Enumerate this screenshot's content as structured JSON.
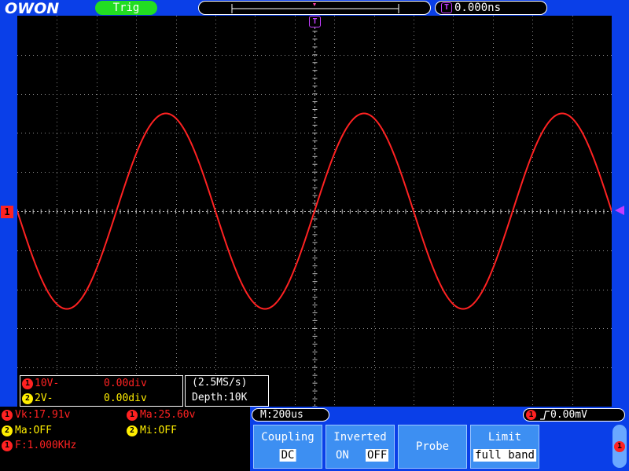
{
  "brand": {
    "logo": "OWON"
  },
  "header": {
    "trig_status": "Trig",
    "trig_time": "0.000ns",
    "trig_icon": "T"
  },
  "channels": {
    "ch1": {
      "num": "1",
      "vdiv": "10V-",
      "pos": "0.00div",
      "color": "#ff2222"
    },
    "ch2": {
      "num": "2",
      "vdiv": "2V-",
      "pos": "0.00div",
      "color": "#ffee00"
    }
  },
  "acquisition": {
    "sample_rate": "(2.5MS/s)",
    "depth": "Depth:10K"
  },
  "measurements": [
    {
      "ch": "1",
      "text": "Vk:17.91v",
      "color": "#ff2222"
    },
    {
      "ch": "1",
      "text": "Ma:25.60v",
      "color": "#ff2222"
    },
    {
      "ch": "2",
      "text": "Ma:OFF",
      "color": "#ffee00"
    },
    {
      "ch": "2",
      "text": "Mi:OFF",
      "color": "#ffee00"
    },
    {
      "ch": "1",
      "text": "F:1.000KHz",
      "color": "#ff2222"
    }
  ],
  "timebase": {
    "label": "M:200us"
  },
  "trigger": {
    "ch": "1",
    "edge_icon": "rising-edge",
    "edge_glyph": "∿",
    "level": "0.00mV"
  },
  "softkeys": {
    "coupling": {
      "label": "Coupling",
      "value": "DC"
    },
    "inverted": {
      "label": "Inverted",
      "on": "ON",
      "off": "OFF"
    },
    "probe": {
      "label": "Probe"
    },
    "limit": {
      "label": "Limit",
      "value": "full band"
    }
  },
  "side_knob": {
    "ch": "1"
  },
  "waveform": {
    "cycles_visible": 3,
    "peak_div": 2.5,
    "color": "#ff2222"
  }
}
